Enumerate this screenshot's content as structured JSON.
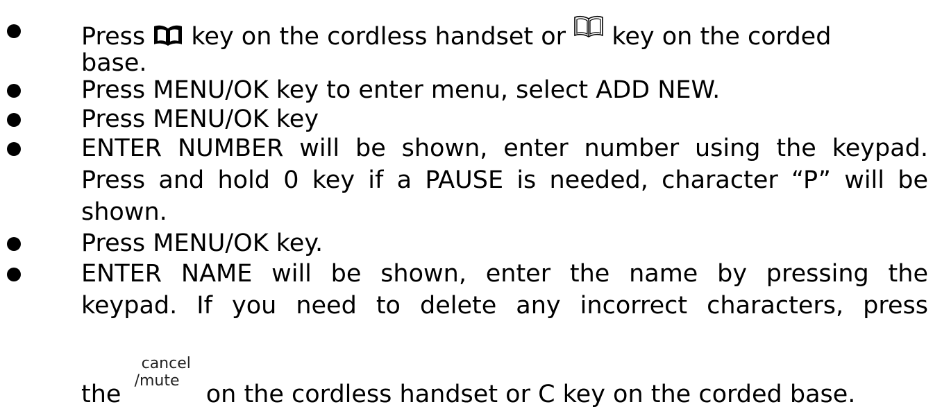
{
  "steps": [
    {
      "line1_pre": "Press",
      "line1_mid": "key on the cordless handset or",
      "line1_post": "key on the corded",
      "line2": "base.",
      "icon1": "phonebook-filled-icon",
      "icon2": "phonebook-outline-icon"
    },
    {
      "text": "Press MENU/OK key to enter menu, select ADD NEW."
    },
    {
      "text": "Press MENU/OK key"
    },
    {
      "line1": "ENTER NUMBER will be shown, enter number using the keypad.",
      "line2": "Press and hold 0 key if a PAUSE is needed, character “P” will be",
      "line3": "shown."
    },
    {
      "text": "Press MENU/OK key."
    },
    {
      "line1": "ENTER NAME will be shown, enter the name by pressing  the",
      "line2": "keypad. If you need to delete any incorrect characters,  press",
      "line3_pre": "the",
      "line3_key_top": "cancel",
      "line3_key_bottom": "/mute",
      "line3_post": "on the cordless handset or C key on the corded base."
    }
  ]
}
